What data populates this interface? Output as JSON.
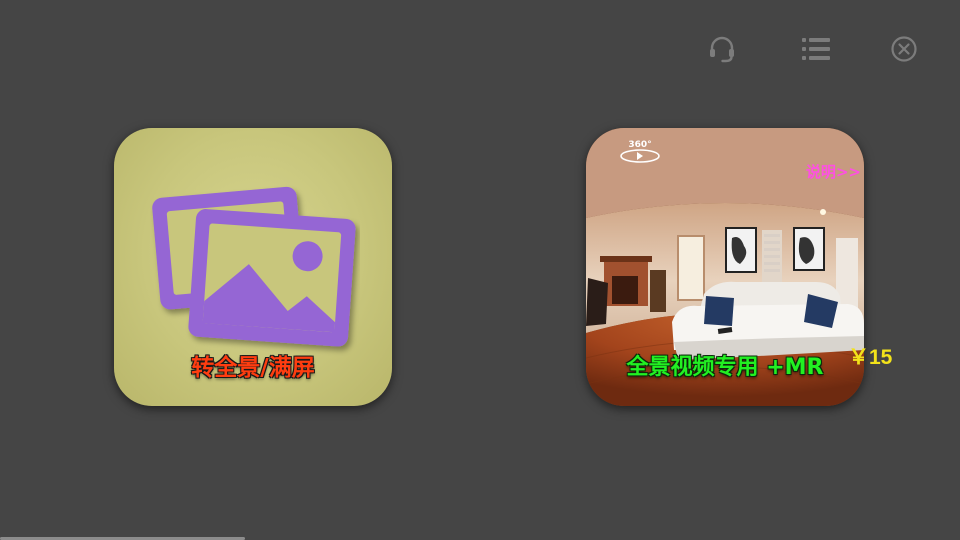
{
  "topbar": {
    "support_icon": "headset-icon",
    "menu_icon": "list-menu-icon",
    "close_icon": "close-circle-icon",
    "icon_color": "#7c7c7c"
  },
  "cards": {
    "fullscreen": {
      "label": "转全景/满屏",
      "icon": "images-icon",
      "label_color": "#ff3d10",
      "icon_color": "#9566d4"
    },
    "panorama": {
      "label": "全景视频专用 +MR",
      "badge_text": "360°",
      "explain_link": "说明>>",
      "price": "￥15",
      "label_color": "#22f022",
      "link_color": "#ff4fe3",
      "price_color": "#f2e21a"
    }
  }
}
